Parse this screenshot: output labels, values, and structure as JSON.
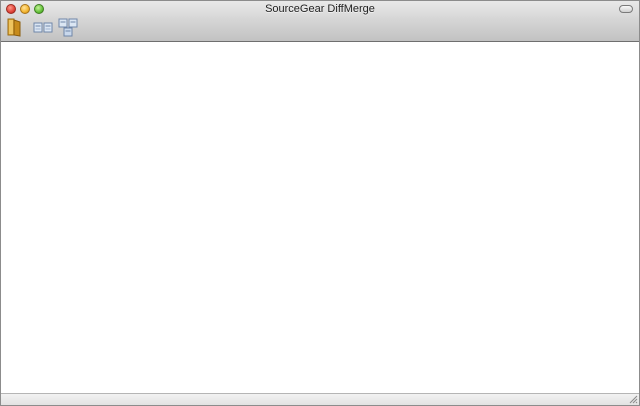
{
  "window": {
    "title": "SourceGear DiffMerge"
  },
  "window_controls": {
    "close_icon": "close-icon",
    "minimize_icon": "minimize-icon",
    "zoom_icon": "zoom-icon"
  },
  "toolbar": {
    "items": [
      {
        "icon": "folder-icon"
      },
      {
        "icon": "diff-two-files-icon"
      },
      {
        "icon": "diff-three-files-icon"
      }
    ]
  },
  "colors": {
    "folder": "#d9a02e",
    "doc_blue": "#c9d8ec",
    "doc_border": "#6f86a8"
  }
}
